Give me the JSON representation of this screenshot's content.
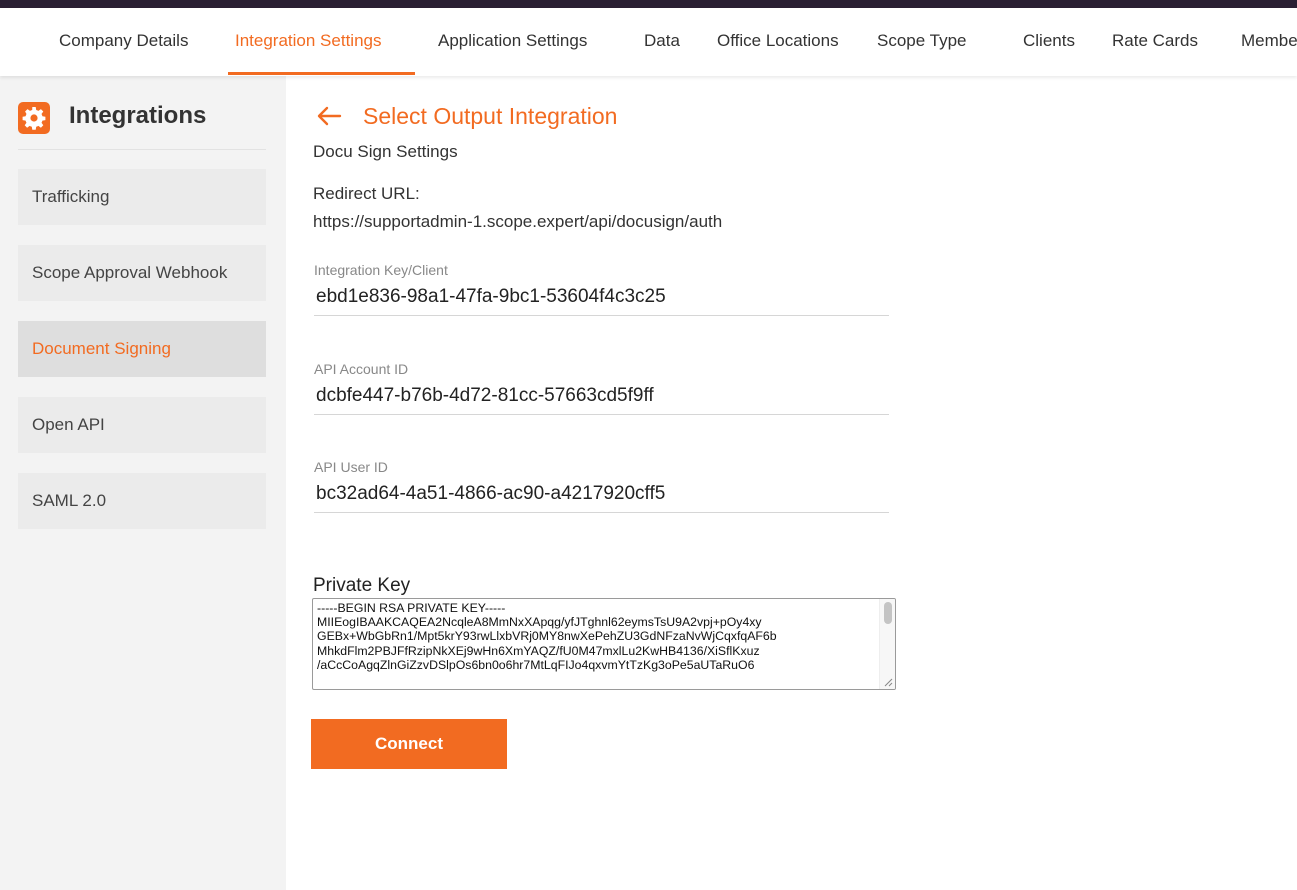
{
  "colors": {
    "accent": "#f26b21",
    "top_bar": "#2a1f33",
    "sidebar_bg": "#f3f3f3"
  },
  "nav": {
    "tabs": [
      {
        "label": "Company Details"
      },
      {
        "label": "Integration Settings"
      },
      {
        "label": "Application Settings"
      },
      {
        "label": "Data"
      },
      {
        "label": "Office Locations"
      },
      {
        "label": "Scope Type"
      },
      {
        "label": "Clients"
      },
      {
        "label": "Rate Cards"
      },
      {
        "label": "Members"
      }
    ],
    "active_tab": "Integration Settings"
  },
  "sidebar": {
    "title": "Integrations",
    "icon": "gear-icon",
    "items": [
      {
        "label": "Trafficking"
      },
      {
        "label": "Scope Approval Webhook"
      },
      {
        "label": "Document Signing"
      },
      {
        "label": "Open API"
      },
      {
        "label": "SAML 2.0"
      }
    ],
    "active_item": "Document Signing"
  },
  "main": {
    "back_icon": "arrow-left-icon",
    "back_title": "Select Output Integration",
    "subtitle": "Docu Sign Settings",
    "redirect_label": "Redirect URL:",
    "redirect_url": "https://supportadmin-1.scope.expert/api/docusign/auth",
    "fields": [
      {
        "label": "Integration Key/Client",
        "value": "ebd1e836-98a1-47fa-9bc1-53604f4c3c25"
      },
      {
        "label": "API Account ID",
        "value": "dcbfe447-b76b-4d72-81cc-57663cd5f9ff"
      },
      {
        "label": "API User ID",
        "value": "bc32ad64-4a51-4866-ac90-a4217920cff5"
      }
    ],
    "private_key_label": "Private Key",
    "private_key_lines": [
      "-----BEGIN RSA PRIVATE KEY-----",
      "MIIEogIBAAKCAQEA2NcqleA8MmNxXApqg/yfJTghnl62eymsTsU9A2vpj+pOy4xy",
      "GEBx+WbGbRn1/Mpt5krY93rwLlxbVRj0MY8nwXePehZU3GdNFzaNvWjCqxfqAF6b",
      "MhkdFlm2PBJFfRzipNkXEj9wHn6XmYAQZ/fU0M47mxlLu2KwHB4136/XiSflKxuz",
      "/aCcCoAgqZlnGiZzvDSlpOs6bn0o6hr7MtLqFIJo4qxvmYtTzKg3oPe5aUTaRuO6"
    ],
    "connect_label": "Connect"
  }
}
